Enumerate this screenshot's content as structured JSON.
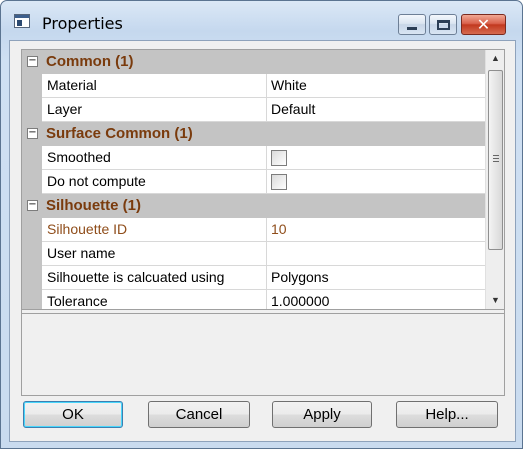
{
  "window": {
    "title": "Properties"
  },
  "categories": [
    {
      "label": "Common (1)",
      "toggle": "−",
      "props": [
        {
          "name": "Material",
          "value": "White",
          "type": "text"
        },
        {
          "name": "Layer",
          "value": "Default",
          "type": "text"
        }
      ]
    },
    {
      "label": "Surface Common (1)",
      "toggle": "−",
      "props": [
        {
          "name": "Smoothed",
          "checked": false,
          "type": "checkbox"
        },
        {
          "name": "Do not compute",
          "checked": false,
          "type": "checkbox"
        }
      ]
    },
    {
      "label": "Silhouette (1)",
      "toggle": "−",
      "props": [
        {
          "name": "Silhouette ID",
          "value": "10",
          "type": "text",
          "readonly": true
        },
        {
          "name": "User name",
          "value": "",
          "type": "text"
        },
        {
          "name": "Silhouette is calcuated using",
          "value": "Polygons",
          "type": "text"
        },
        {
          "name": "Tolerance",
          "value": "1.000000",
          "type": "text"
        }
      ]
    }
  ],
  "buttons": {
    "ok": "OK",
    "cancel": "Cancel",
    "apply": "Apply",
    "help": "Help..."
  },
  "icons": {
    "minimize": "minimize-icon",
    "maximize": "maximize-icon",
    "close": "close-icon",
    "app": "properties-window-icon"
  },
  "colors": {
    "category_text": "#7a3b0d",
    "readonly_text": "#8f4d1a",
    "close_button": "#c2391f"
  }
}
